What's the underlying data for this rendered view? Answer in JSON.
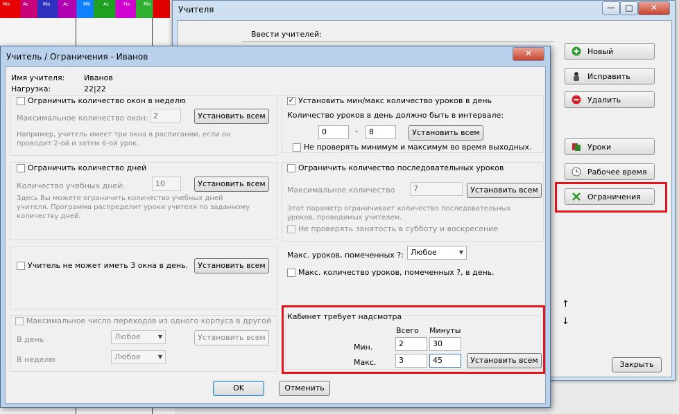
{
  "bg_strip_cells": [
    "Ma",
    "Ac",
    "Ma",
    "Ac",
    "Mb",
    "Ac",
    "Ha",
    "Ma"
  ],
  "main_window": {
    "title": "Учителя",
    "min_glyph": "—",
    "max_glyph": "□",
    "close_glyph": "✕",
    "enter_teachers": "Ввести учителей:",
    "buttons": {
      "new": "Новый",
      "edit": "Исправить",
      "delete": "Удалить",
      "lessons": "Уроки",
      "working_time": "Рабочее время",
      "constraints": "Ограничения",
      "close": "Закрыть"
    },
    "arrow_up": "↑",
    "arrow_down": "↓"
  },
  "dialog": {
    "title": "Учитель / Ограничения - Иванов",
    "close_glyph": "✕",
    "teacher_name_label": "Имя учителя:",
    "teacher_name_value": "Иванов",
    "load_label": "Нагрузка:",
    "load_value": "22|22",
    "set_all": "Установить всем",
    "gaps": {
      "checkbox": "Ограничить количество окон в неделю",
      "max_label": "Максимальное количество окон:",
      "max_value": "2",
      "hint": "Например, учитель имеет три окна в расписании, если он проводит 2-ой и затем 6-ой урок."
    },
    "days": {
      "checkbox": "Ограничить количество дней",
      "count_label": "Количество учебных дней:",
      "count_value": "10",
      "hint": "Здесь Вы можете ограничить количество учебных дней учителя. Программа распределит уроки учителя по заданному количеству дней."
    },
    "three_gaps": {
      "checkbox": "Учитель не может иметь 3 окна в день."
    },
    "buildings": {
      "checkbox": "Максимальное число переходов из одного корпуса в другой",
      "per_day_label": "В день",
      "per_day_value": "Любое",
      "per_week_label": "В неделю",
      "per_week_value": "Любое"
    },
    "minmax": {
      "checkbox": "Установить мин/макс количество уроков в день",
      "checked_glyph": "✓",
      "interval_label": "Количество уроков в день должно быть в интервале:",
      "min_value": "0",
      "dash": "-",
      "max_value": "8",
      "weekend_checkbox": "Не проверять минимум и максимум во время выходных."
    },
    "consecutive": {
      "checkbox": "Ограничить количество последовательных уроков",
      "max_label": "Максимальное количество",
      "max_value": "7",
      "hint": "Этот параметр ограничивает количество последовательных уроков, проводимых учителем.",
      "weekend_checkbox": "Не проверять занятость в субботу и воскресение"
    },
    "marked": {
      "max_label": "Макс. уроков, помеченных ?:",
      "max_value": "Любое",
      "per_day_checkbox": "Макс. количество уроков, помеченных ?, в день."
    },
    "supervision": {
      "title": "Кабинет требует надсмотра",
      "col_total": "Всего",
      "col_minutes": "Минуты",
      "row_min": "Мин.",
      "row_max": "Макс.",
      "min_total": "2",
      "min_minutes": "30",
      "max_total": "3",
      "max_minutes": "45"
    },
    "ok": "OK",
    "cancel": "Отменить"
  },
  "colors": {
    "highlight": "#e5141c",
    "dialog_frame": "#b9d1ea"
  }
}
